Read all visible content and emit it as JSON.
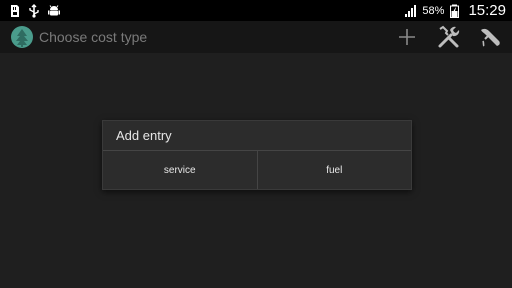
{
  "status_bar": {
    "left_icons": [
      "sd-card-icon",
      "usb-icon",
      "android-debug-icon"
    ],
    "battery_percent": "58%",
    "time": "15:29"
  },
  "action_bar": {
    "title": "Choose cost type",
    "actions": [
      "add-icon",
      "tools-icon",
      "fuel-nozzle-icon"
    ]
  },
  "dialog": {
    "title": "Add entry",
    "buttons": [
      "service",
      "fuel"
    ]
  },
  "colors": {
    "status_bar_bg": "#000000",
    "action_bar_bg": "#161616",
    "content_bg": "#1f1f1f",
    "dialog_bg": "#2c2c2c",
    "app_icon_accent": "#4a9c8c"
  }
}
